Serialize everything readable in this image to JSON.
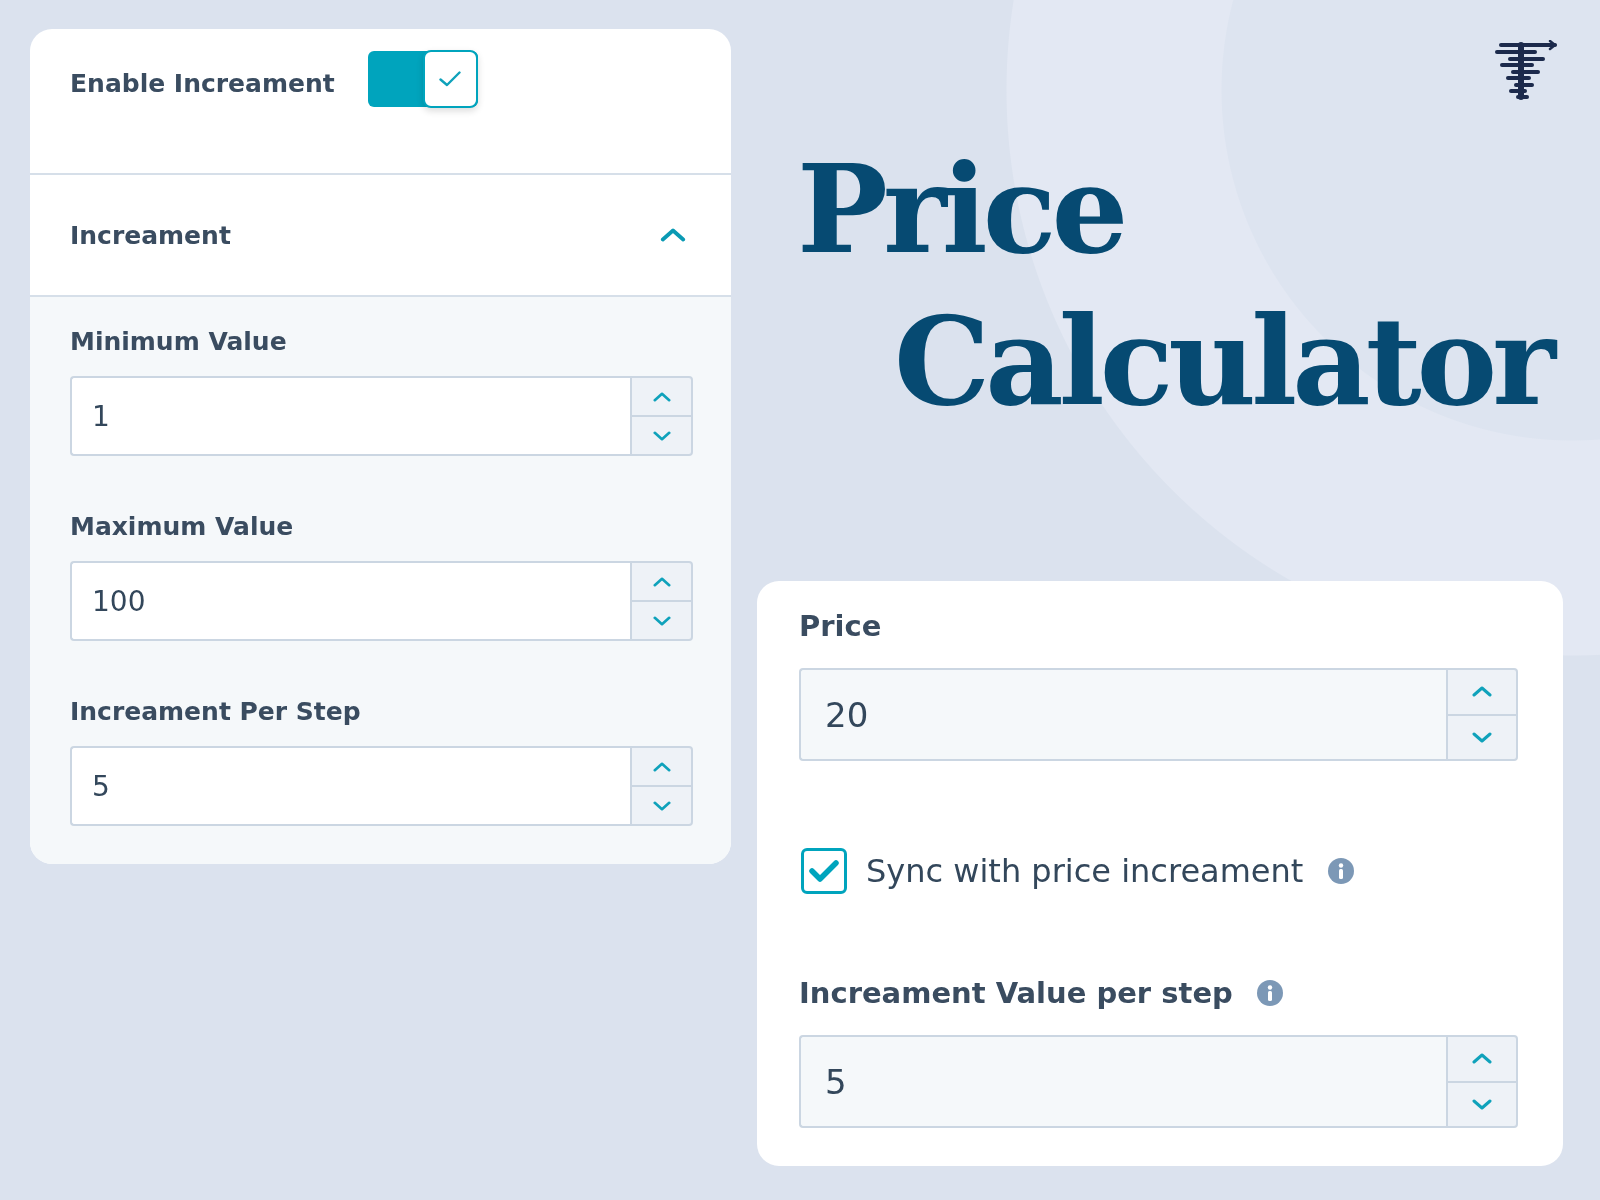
{
  "settings_card": {
    "enable_increment": {
      "label": "Enable Increament",
      "on": true
    },
    "section": {
      "title": "Increament",
      "expanded": true,
      "fields": [
        {
          "label": "Minimum Value",
          "value": "1"
        },
        {
          "label": "Maximum Value",
          "value": "100"
        },
        {
          "label": "Increament Per Step",
          "value": "5"
        }
      ]
    }
  },
  "heading": {
    "lines": [
      "Price",
      "Calculator"
    ]
  },
  "price_card": {
    "price": {
      "label": "Price",
      "value": "20"
    },
    "sync": {
      "label": "Sync with price increament",
      "checked": true
    },
    "step": {
      "label": "Increament Value per step",
      "value": "5"
    }
  }
}
